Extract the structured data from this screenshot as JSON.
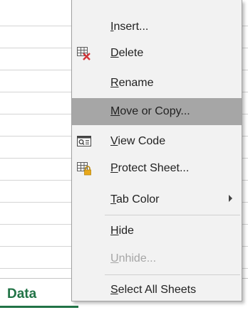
{
  "sheet": {
    "tab_label": "Data",
    "tab_color": "#217346"
  },
  "context_menu": {
    "items": [
      {
        "pre": "",
        "key": "I",
        "post": "nsert...",
        "icon": "",
        "state": "normal"
      },
      {
        "pre": "",
        "key": "D",
        "post": "elete",
        "icon": "delete-sheet-icon",
        "state": "normal"
      },
      {
        "pre": "",
        "key": "R",
        "post": "ename",
        "icon": "",
        "state": "normal"
      },
      {
        "pre": "",
        "key": "M",
        "post": "ove or Copy...",
        "icon": "",
        "state": "highlighted"
      },
      {
        "pre": "",
        "key": "V",
        "post": "iew Code",
        "icon": "view-code-icon",
        "state": "normal"
      },
      {
        "pre": "",
        "key": "P",
        "post": "rotect Sheet...",
        "icon": "protect-sheet-icon",
        "state": "normal"
      },
      {
        "pre": "",
        "key": "T",
        "post": "ab Color",
        "icon": "",
        "state": "normal",
        "submenu": true
      },
      {
        "pre": "",
        "key": "H",
        "post": "ide",
        "icon": "",
        "state": "normal"
      },
      {
        "pre": "",
        "key": "U",
        "post": "nhide...",
        "icon": "",
        "state": "disabled"
      },
      {
        "pre": "",
        "key": "S",
        "post": "elect All Sheets",
        "icon": "",
        "state": "normal"
      }
    ]
  },
  "colors": {
    "menu_background": "#f2f2f2",
    "highlight": "#a6a6a6",
    "disabled_text": "#a6a6a6",
    "accent": "#217346"
  }
}
